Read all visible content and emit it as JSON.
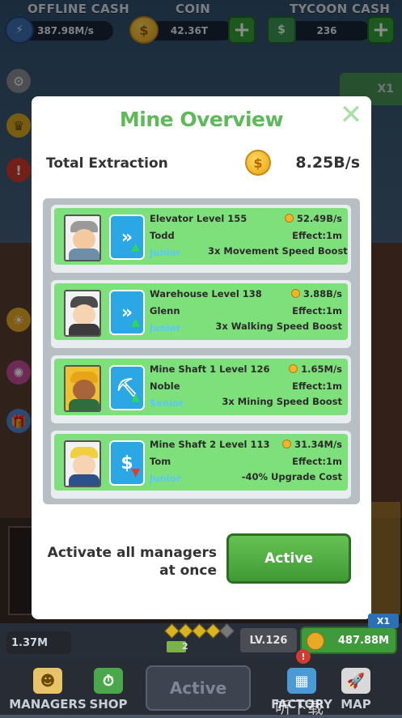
{
  "topbar": {
    "offline_cash": {
      "label": "OFFLINE CASH",
      "value": "387.98M/s"
    },
    "coin": {
      "label": "COIN",
      "value": "42.36T"
    },
    "tycoon_cash": {
      "label": "TYCOON CASH",
      "value": "236"
    },
    "plus": "+"
  },
  "boost": {
    "label": "X1"
  },
  "modal": {
    "title": "Mine Overview",
    "close": "✕",
    "total_label": "Total Extraction",
    "total_coin": "$",
    "total_value": "8.25B/s",
    "managers": [
      {
        "title": "Elevator Level 155",
        "name": "Todd",
        "rank": "Junior",
        "income": "52.49B/s",
        "effect": "Effect:1m",
        "boost": "3x Movement Speed Boost",
        "skill_glyph": "»",
        "skill_arrow": "▲",
        "avatar": "manager-elevator"
      },
      {
        "title": "Warehouse Level 138",
        "name": "Glenn",
        "rank": "Junior",
        "income": "3.88B/s",
        "effect": "Effect:1m",
        "boost": "3x Walking Speed Boost",
        "skill_glyph": "»",
        "skill_arrow": "▲",
        "avatar": "manager-warehouse"
      },
      {
        "title": "Mine Shaft 1 Level 126",
        "name": "Noble",
        "rank": "Senior",
        "income": "1.65M/s",
        "effect": "Effect:1m",
        "boost": "3x Mining Speed Boost",
        "skill_glyph": "⛏",
        "skill_arrow": "▲",
        "avatar": "manager-shaft-1"
      },
      {
        "title": "Mine Shaft 2 Level 113",
        "name": "Tom",
        "rank": "Junior",
        "income": "31.34M/s",
        "effect": "Effect:1m",
        "boost": "-40% Upgrade Cost",
        "skill_glyph": "$",
        "skill_arrow": "▼",
        "avatar": "manager-shaft-2"
      }
    ],
    "activate_label": "Activate all managers at once",
    "active_button": "Active"
  },
  "bottom": {
    "left_cash": "1.37M",
    "cart_count": "2",
    "level": "LV.126",
    "mine_cash": "487.88M",
    "x1": "X1",
    "nav": {
      "managers": "MANAGERS",
      "shop": "SHOP",
      "active": "Active",
      "factory": "FACTORY",
      "map": "MAP",
      "badge": "!"
    },
    "watermark": "听下载"
  },
  "colors": {
    "accent_green": "#5fb85a",
    "card_green": "#7ee07a",
    "skill_blue": "#2aa7e4",
    "rank_blue": "#58c8ff"
  }
}
